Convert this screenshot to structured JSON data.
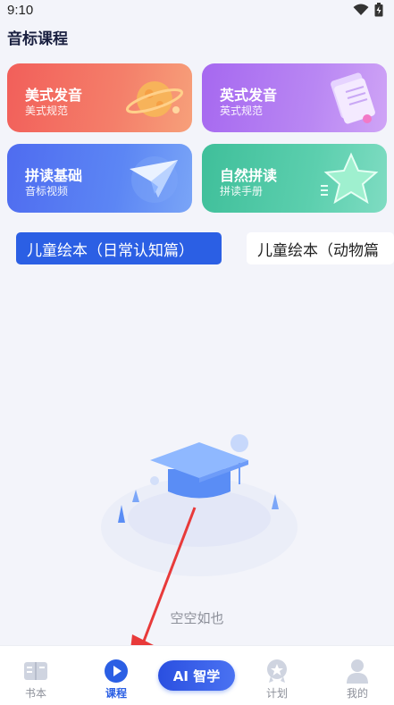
{
  "status_bar": {
    "time": "9:10",
    "wifi_icon": "wifi-icon",
    "battery_icon": "battery-charging-icon"
  },
  "page_title": "音标课程",
  "cards": [
    {
      "title": "美式发音",
      "subtitle": "美式规范",
      "icon": "planet-icon"
    },
    {
      "title": "英式发音",
      "subtitle": "英式规范",
      "icon": "papers-icon"
    },
    {
      "title": "拼读基础",
      "subtitle": "音标视频",
      "icon": "paper-plane-icon"
    },
    {
      "title": "自然拼读",
      "subtitle": "拼读手册",
      "icon": "star-icon"
    }
  ],
  "tabs": [
    {
      "label": "儿童绘本（日常认知篇）",
      "active": true
    },
    {
      "label": "儿童绘本（动物篇",
      "active": false
    }
  ],
  "empty_state": {
    "text": "空空如也",
    "icon": "graduation-cap-icon"
  },
  "bottom_nav": {
    "items": [
      {
        "label": "书本",
        "icon": "book-icon"
      },
      {
        "label": "课程",
        "icon": "play-circle-icon",
        "active": true
      },
      {
        "label": "计划",
        "icon": "badge-icon"
      },
      {
        "label": "我的",
        "icon": "person-icon"
      }
    ],
    "ai_button": "AI 智学"
  },
  "colors": {
    "accent": "#2b5fe4",
    "background": "#f3f4fa"
  }
}
